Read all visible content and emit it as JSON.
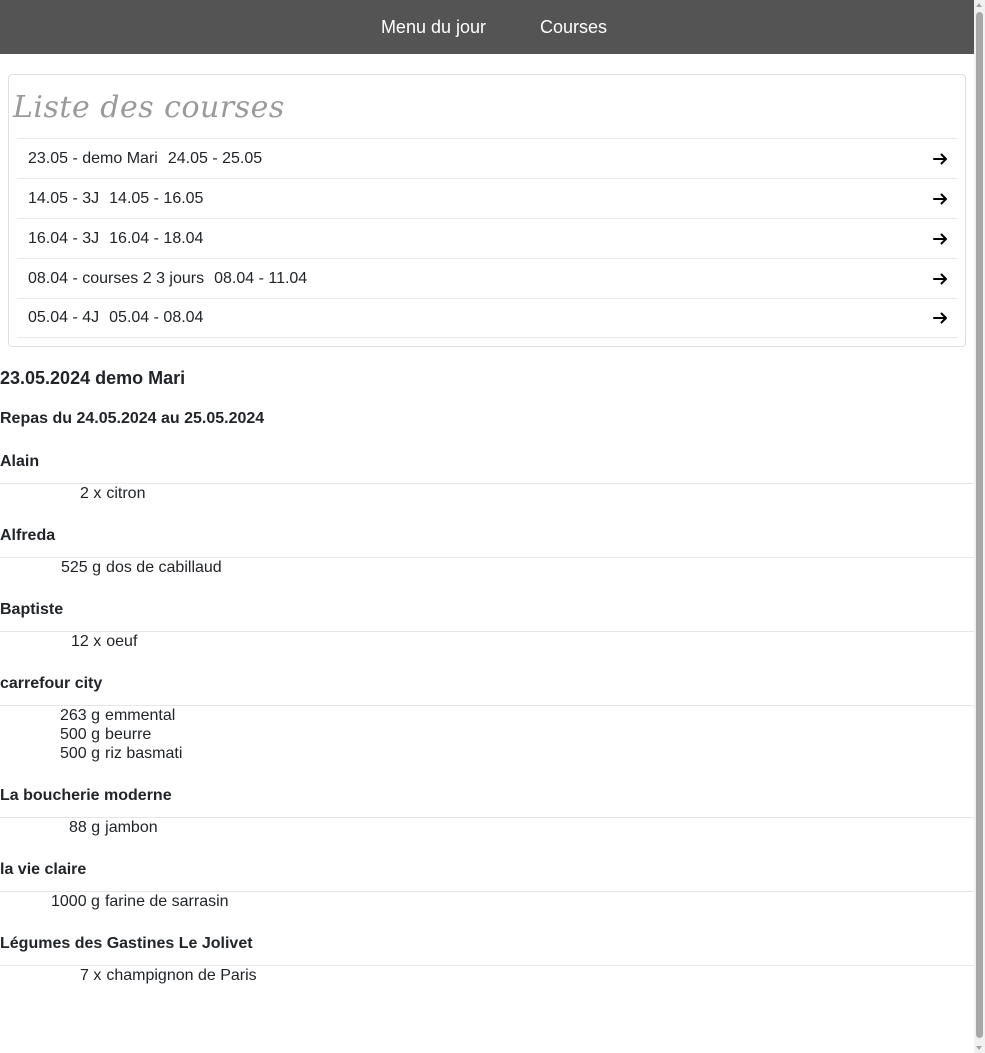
{
  "nav": {
    "items": [
      "Menu du jour",
      "Courses"
    ]
  },
  "card": {
    "title": "Liste des courses",
    "lists": [
      {
        "name": "23.05 - demo Mari",
        "dates": "24.05 - 25.05"
      },
      {
        "name": "14.05 - 3J",
        "dates": "14.05 - 16.05"
      },
      {
        "name": "16.04 - 3J",
        "dates": "16.04 - 18.04"
      },
      {
        "name": "08.04 - courses 2 3 jours",
        "dates": "08.04 - 11.04"
      },
      {
        "name": "05.04 - 4J",
        "dates": "05.04 - 08.04"
      }
    ],
    "arrow_icon": "arrow-right-icon"
  },
  "detail": {
    "title": "23.05.2024 demo Mari",
    "subtitle": "Repas du 24.05.2024 au 25.05.2024",
    "shops": [
      {
        "name": "Alain",
        "items": [
          {
            "qty": "2 x",
            "name": "citron"
          }
        ]
      },
      {
        "name": "Alfreda",
        "items": [
          {
            "qty": "525 g",
            "name": "dos de cabillaud"
          }
        ]
      },
      {
        "name": "Baptiste",
        "items": [
          {
            "qty": "12 x",
            "name": "oeuf"
          }
        ]
      },
      {
        "name": "carrefour city",
        "items": [
          {
            "qty": "263 g",
            "name": "emmental"
          },
          {
            "qty": "500 g",
            "name": "beurre"
          },
          {
            "qty": "500 g",
            "name": "riz basmati"
          }
        ]
      },
      {
        "name": "La boucherie moderne",
        "items": [
          {
            "qty": "88 g",
            "name": "jambon"
          }
        ]
      },
      {
        "name": "la vie claire",
        "items": [
          {
            "qty": "1000 g",
            "name": "farine de sarrasin"
          }
        ]
      },
      {
        "name": "Légumes des Gastines Le Jolivet",
        "items": [
          {
            "qty": "7 x",
            "name": "champignon de Paris"
          }
        ]
      }
    ]
  },
  "colors": {
    "navbar": "#545454",
    "title_gray": "#9a9a9a",
    "text": "#212529"
  }
}
